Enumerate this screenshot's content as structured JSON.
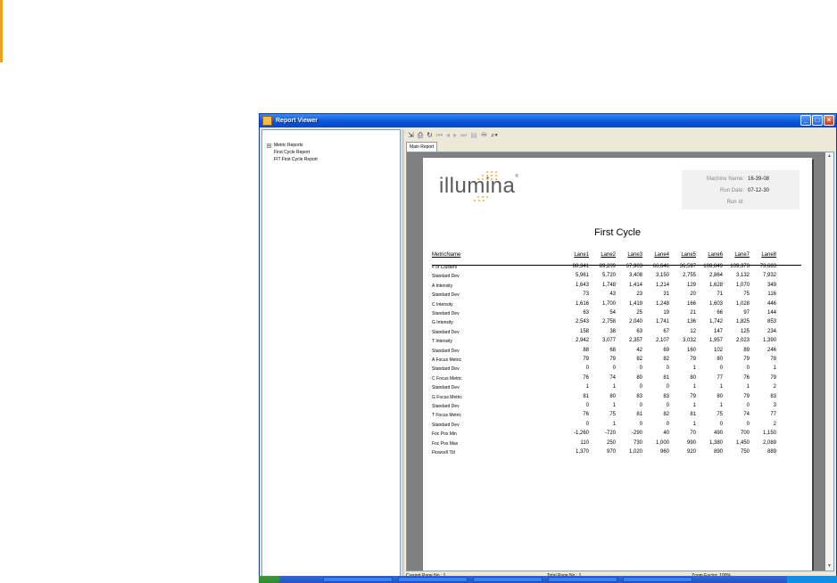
{
  "window": {
    "title": "Report Viewer"
  },
  "tree": [
    {
      "label": "Metric Reports",
      "expander": "+"
    },
    {
      "label": "First Cycle Report"
    },
    {
      "label": "FIT First Cycle Report"
    }
  ],
  "toolbar_icons": [
    "export-icon",
    "print-icon",
    "refresh-icon",
    "first-page-icon",
    "prev-page-icon",
    "next-page-icon",
    "last-page-icon",
    "page-setup-icon",
    "find-icon",
    "zoom-dropdown-icon"
  ],
  "tab": {
    "label": "Main Report"
  },
  "report": {
    "logo_text": "illumina",
    "logo_reg": "®",
    "info": [
      {
        "label": "Machine Name:",
        "value": "16-39-08"
      },
      {
        "label": "Run Date:",
        "value": "07-12-30"
      },
      {
        "label": "Run Id:",
        "value": ""
      }
    ],
    "title": "First Cycle",
    "columns": [
      "MetricName",
      "Lane1",
      "Lane2",
      "Lane3",
      "Lane4",
      "Lane5",
      "Lane6",
      "Lane7",
      "Lane8"
    ],
    "rows": [
      {
        "name": "# of Clusters",
        "values": [
          "88,341",
          "89,209",
          "67,903",
          "66,646",
          "36,597",
          "108,849",
          "109,373",
          "73,683"
        ]
      },
      {
        "name": "Standard Dev",
        "values": [
          "5,961",
          "5,720",
          "3,408",
          "3,150",
          "2,755",
          "2,864",
          "3,132",
          "7,932"
        ]
      },
      {
        "name": "A Intensity",
        "values": [
          "1,643",
          "1,748",
          "1,414",
          "1,214",
          "129",
          "1,628",
          "1,070",
          "349"
        ]
      },
      {
        "name": "Standard Dev",
        "values": [
          "73",
          "43",
          "23",
          "31",
          "20",
          "71",
          "75",
          "116"
        ]
      },
      {
        "name": "C Intensity",
        "values": [
          "1,616",
          "1,700",
          "1,419",
          "1,248",
          "166",
          "1,603",
          "1,028",
          "446"
        ]
      },
      {
        "name": "Standard Dev",
        "values": [
          "63",
          "54",
          "25",
          "19",
          "21",
          "66",
          "97",
          "144"
        ]
      },
      {
        "name": "G Intensity",
        "values": [
          "2,543",
          "2,758",
          "2,040",
          "1,741",
          "136",
          "1,742",
          "1,825",
          "853"
        ]
      },
      {
        "name": "Standard Dev",
        "values": [
          "158",
          "38",
          "63",
          "67",
          "12",
          "147",
          "125",
          "234"
        ]
      },
      {
        "name": "T Intensity",
        "values": [
          "2,942",
          "3,077",
          "2,357",
          "2,107",
          "3,032",
          "1,957",
          "2,023",
          "1,390"
        ]
      },
      {
        "name": "Standard Dev",
        "values": [
          "88",
          "68",
          "42",
          "69",
          "160",
          "102",
          "89",
          "246"
        ]
      },
      {
        "name": "A Focus Metric",
        "values": [
          "79",
          "79",
          "82",
          "82",
          "79",
          "80",
          "79",
          "78"
        ]
      },
      {
        "name": "Standard Dev",
        "values": [
          "0",
          "0",
          "0",
          "0",
          "1",
          "0",
          "0",
          "1"
        ]
      },
      {
        "name": "C Focus Metric",
        "values": [
          "76",
          "74",
          "80",
          "81",
          "80",
          "77",
          "76",
          "79"
        ]
      },
      {
        "name": "Standard Dev",
        "values": [
          "1",
          "1",
          "0",
          "0",
          "1",
          "1",
          "1",
          "2"
        ]
      },
      {
        "name": "G Focus Metric",
        "values": [
          "81",
          "80",
          "83",
          "83",
          "79",
          "80",
          "79",
          "83"
        ]
      },
      {
        "name": "Standard Dev",
        "values": [
          "0",
          "1",
          "0",
          "0",
          "1",
          "1",
          "0",
          "3"
        ]
      },
      {
        "name": "T Focus Metric",
        "values": [
          "76",
          "75",
          "81",
          "82",
          "81",
          "75",
          "74",
          "77"
        ]
      },
      {
        "name": "Standard Dev",
        "values": [
          "0",
          "1",
          "0",
          "0",
          "1",
          "0",
          "0",
          "2"
        ]
      },
      {
        "name": "Foc Pos Min",
        "values": [
          "-1,260",
          "-720",
          "-290",
          "40",
          "70",
          "490",
          "700",
          "1,150"
        ]
      },
      {
        "name": "Foc Pos Max",
        "values": [
          "110",
          "250",
          "730",
          "1,000",
          "990",
          "1,380",
          "1,450",
          "2,089"
        ]
      },
      {
        "name": "Flowcell Tilt",
        "values": [
          "1,370",
          "970",
          "1,020",
          "960",
          "920",
          "890",
          "750",
          "889"
        ]
      }
    ]
  },
  "status": {
    "current_page": "Current Page No.: 1",
    "total_pages": "Total Page No.: 1",
    "zoom": "Zoom Factor: 100%"
  },
  "colors": {
    "title_bar": "#0a55d8",
    "accent": "#f0a020",
    "logo_dots": "#f0b040"
  }
}
